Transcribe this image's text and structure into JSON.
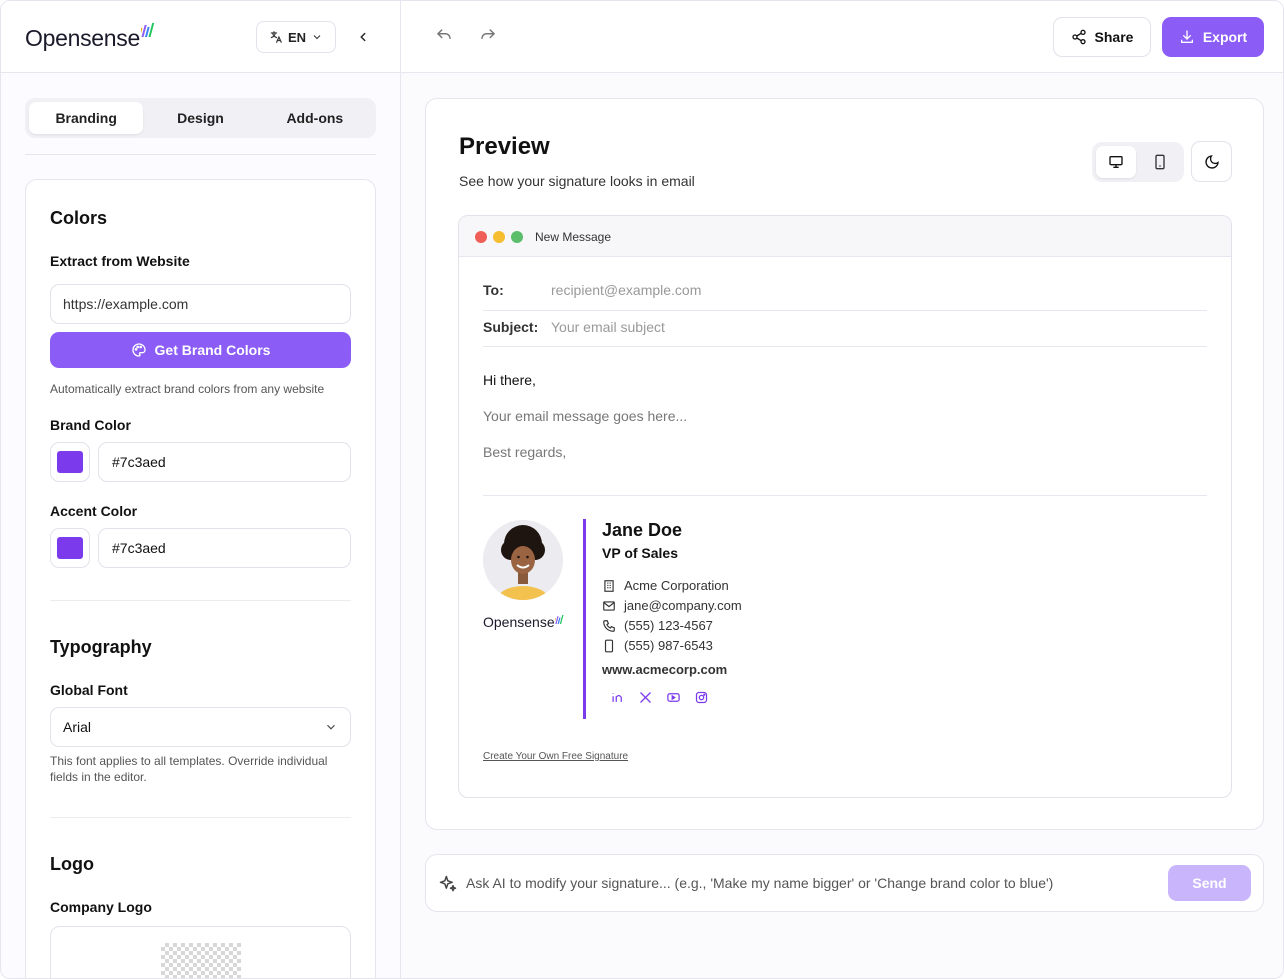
{
  "brand": {
    "logo_text": "Opensense",
    "accent": "#8b5cf6",
    "disabled_accent": "#c9b5fb"
  },
  "header": {
    "language": "EN"
  },
  "tabs": [
    {
      "label": "Branding",
      "active": true
    },
    {
      "label": "Design",
      "active": false
    },
    {
      "label": "Add-ons",
      "active": false
    }
  ],
  "colors_section": {
    "title": "Colors",
    "extract_label": "Extract from Website",
    "url_placeholder": "https://example.com",
    "get_colors_label": "Get Brand Colors",
    "extract_hint": "Automatically extract brand colors from any website",
    "brand_color_label": "Brand Color",
    "brand_color_value": "#7c3aed",
    "accent_color_label": "Accent Color",
    "accent_color_value": "#7c3aed"
  },
  "typography_section": {
    "title": "Typography",
    "font_label": "Global Font",
    "font_value": "Arial",
    "font_hint": "This font applies to all templates. Override individual fields in the editor."
  },
  "logo_section": {
    "title": "Logo",
    "company_logo_label": "Company Logo"
  },
  "toolbar": {
    "share_label": "Share",
    "export_label": "Export"
  },
  "preview": {
    "title": "Preview",
    "subtitle": "See how your signature looks in email",
    "email": {
      "window_title": "New Message",
      "to_label": "To:",
      "to_value": "recipient@example.com",
      "subject_label": "Subject:",
      "subject_value": "Your email subject",
      "greeting": "Hi there,",
      "message": "Your email message goes here...",
      "closing": "Best regards,"
    },
    "signature": {
      "logo_text": "Opensense",
      "name": "Jane Doe",
      "title": "VP of Sales",
      "company": "Acme Corporation",
      "email": "jane@company.com",
      "phone": "(555) 123-4567",
      "mobile": "(555) 987-6543",
      "website": "www.acmecorp.com",
      "socials": [
        "linkedin-icon",
        "x-icon",
        "youtube-icon",
        "instagram-icon"
      ],
      "cta": "Create Your Own Free Signature"
    }
  },
  "ai": {
    "placeholder": "Ask AI to modify your signature... (e.g., 'Make my name bigger' or 'Change brand color to blue')",
    "send_label": "Send"
  }
}
